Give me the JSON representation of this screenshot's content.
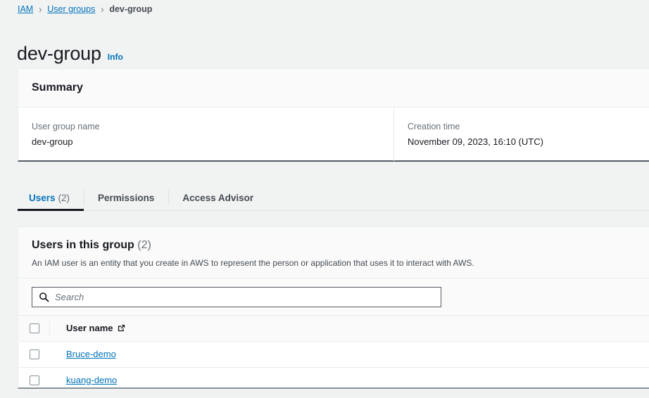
{
  "breadcrumb": {
    "items": [
      {
        "label": "IAM",
        "link": true
      },
      {
        "label": "User groups",
        "link": true
      },
      {
        "label": "dev-group",
        "link": false
      }
    ],
    "separator": "›"
  },
  "header": {
    "title": "dev-group",
    "info_label": "Info"
  },
  "summary": {
    "panel_title": "Summary",
    "fields": [
      {
        "label": "User group name",
        "value": "dev-group"
      },
      {
        "label": "Creation time",
        "value": "November 09, 2023, 16:10 (UTC)"
      }
    ]
  },
  "tabs": [
    {
      "label": "Users",
      "count": "(2)",
      "active": true
    },
    {
      "label": "Permissions",
      "count": "",
      "active": false
    },
    {
      "label": "Access Advisor",
      "count": "",
      "active": false
    }
  ],
  "users_panel": {
    "title": "Users in this group",
    "count": "(2)",
    "description": "An IAM user is an entity that you create in AWS to represent the person or application that uses it to interact with AWS.",
    "search": {
      "placeholder": "Search",
      "value": "",
      "icon": "search-icon"
    },
    "table": {
      "columns": [
        {
          "key": "select",
          "label": ""
        },
        {
          "key": "user_name",
          "label": "User name",
          "icon": "external-link-icon"
        }
      ],
      "rows": [
        {
          "selected": false,
          "user_name": "Bruce-demo"
        },
        {
          "selected": false,
          "user_name": "kuang-demo"
        }
      ]
    }
  },
  "colors": {
    "page_background": "#f1f3f3",
    "panel_background": "#ffffff",
    "link": "#0073bb",
    "text": "#16191f",
    "muted_text": "#687078",
    "border": "#eaeded",
    "active_tab_underline": "#16191f"
  }
}
